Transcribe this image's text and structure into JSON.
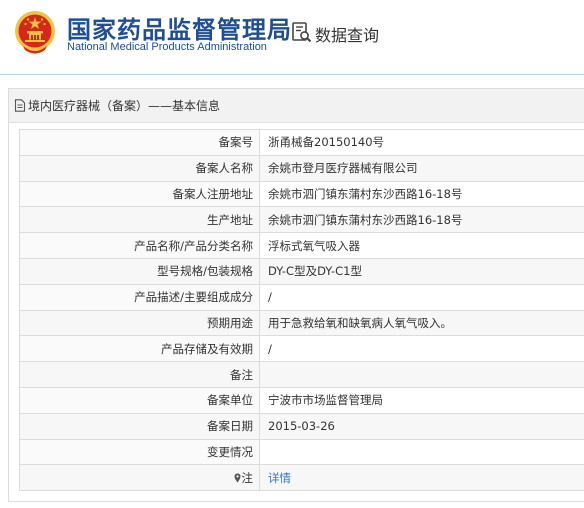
{
  "header": {
    "brand_cn": "国家药品监督管理局",
    "brand_en": "National Medical Products Administration",
    "query_title": "数据查询",
    "query_icon": "search-document-icon",
    "emblem_icon": "national-emblem-icon"
  },
  "panel": {
    "title": "境内医疗器械（备案）——基本信息",
    "title_icon": "document-icon"
  },
  "rows": [
    {
      "label": "备案号",
      "value": "浙甬械备20150140号"
    },
    {
      "label": "备案人名称",
      "value": "余姚市登月医疗器械有限公司"
    },
    {
      "label": "备案人注册地址",
      "value": "余姚市泗门镇东蒲村东沙西路16-18号"
    },
    {
      "label": "生产地址",
      "value": "余姚市泗门镇东蒲村东沙西路16-18号"
    },
    {
      "label": "产品名称/产品分类名称",
      "value": "浮标式氧气吸入器"
    },
    {
      "label": "型号规格/包装规格",
      "value": "DY-C型及DY-C1型"
    },
    {
      "label": "产品描述/主要组成成分",
      "value": "/"
    },
    {
      "label": "预期用途",
      "value": "用于急救给氧和缺氧病人氧气吸入。"
    },
    {
      "label": "产品存储及有效期",
      "value": "/"
    },
    {
      "label": "备注",
      "value": ""
    },
    {
      "label": "备案单位",
      "value": "宁波市市场监督管理局"
    },
    {
      "label": "备案日期",
      "value": "2015-03-26"
    },
    {
      "label": "变更情况",
      "value": ""
    },
    {
      "label": "注",
      "value": "详情",
      "icon": "location-pin-icon"
    }
  ],
  "colors": {
    "brand_blue": "#1e4e95",
    "link_blue": "#2f75c8",
    "emblem_red": "#d7261b",
    "emblem_gold": "#f2c33b"
  }
}
